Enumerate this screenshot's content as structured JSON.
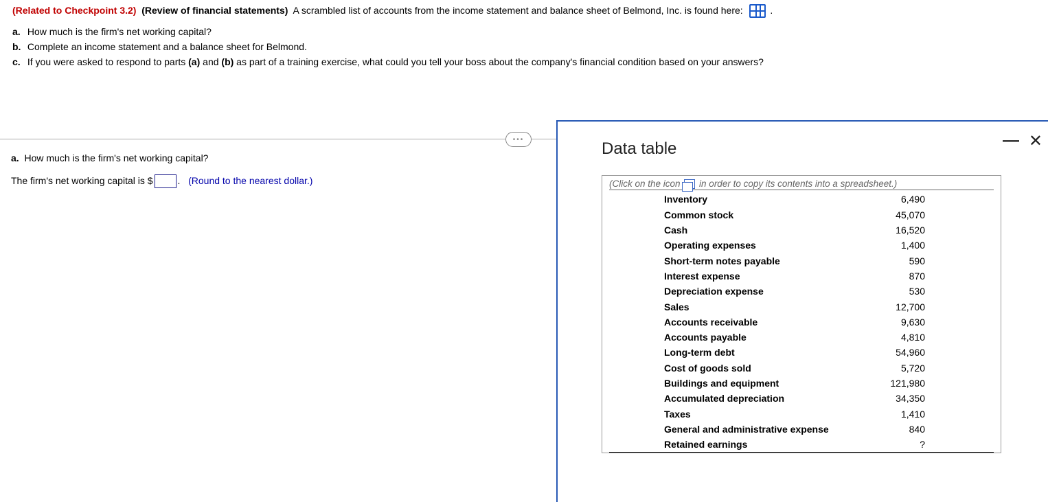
{
  "header": {
    "checkpoint": "(Related to Checkpoint 3.2)",
    "subject": "(Review of financial statements)",
    "lead_text": "A scrambled list of accounts from the income statement and balance sheet of Belmond, Inc. is found here:",
    "period": "."
  },
  "questions": {
    "a": "How much is the firm's net working capital?",
    "b": "Complete an income statement and a balance sheet for Belmond.",
    "c_pre": "If you were asked to respond to parts ",
    "c_a": "(a)",
    "c_and": " and ",
    "c_b": "(b)",
    "c_post": " as part of a training exercise, what could you tell your boss about the company's financial condition based on your answers?"
  },
  "answer": {
    "label": "a.",
    "q": "How much is the firm's net working capital?",
    "sentence_pre": "The firm's net working capital is $",
    "sentence_post": ".",
    "hint": "(Round to the nearest dollar.)"
  },
  "panel": {
    "title": "Data table",
    "note_pre": "(Click on the icon ",
    "note_post": " in order to copy its contents into a spreadsheet.)"
  },
  "chart_data": {
    "type": "table",
    "rows": [
      {
        "label": "Inventory",
        "value": "6,490"
      },
      {
        "label": "Common stock",
        "value": "45,070"
      },
      {
        "label": "Cash",
        "value": "16,520"
      },
      {
        "label": "Operating expenses",
        "value": "1,400"
      },
      {
        "label": "Short-term notes payable",
        "value": "590"
      },
      {
        "label": "Interest expense",
        "value": "870"
      },
      {
        "label": "Depreciation expense",
        "value": "530"
      },
      {
        "label": "Sales",
        "value": "12,700"
      },
      {
        "label": "Accounts receivable",
        "value": "9,630"
      },
      {
        "label": "Accounts payable",
        "value": "4,810"
      },
      {
        "label": "Long-term debt",
        "value": "54,960"
      },
      {
        "label": "Cost of goods sold",
        "value": "5,720"
      },
      {
        "label": "Buildings and equipment",
        "value": "121,980"
      },
      {
        "label": "Accumulated depreciation",
        "value": "34,350"
      },
      {
        "label": "Taxes",
        "value": "1,410"
      },
      {
        "label": "General and administrative expense",
        "value": "840"
      },
      {
        "label": "Retained earnings",
        "value": "?"
      }
    ]
  }
}
